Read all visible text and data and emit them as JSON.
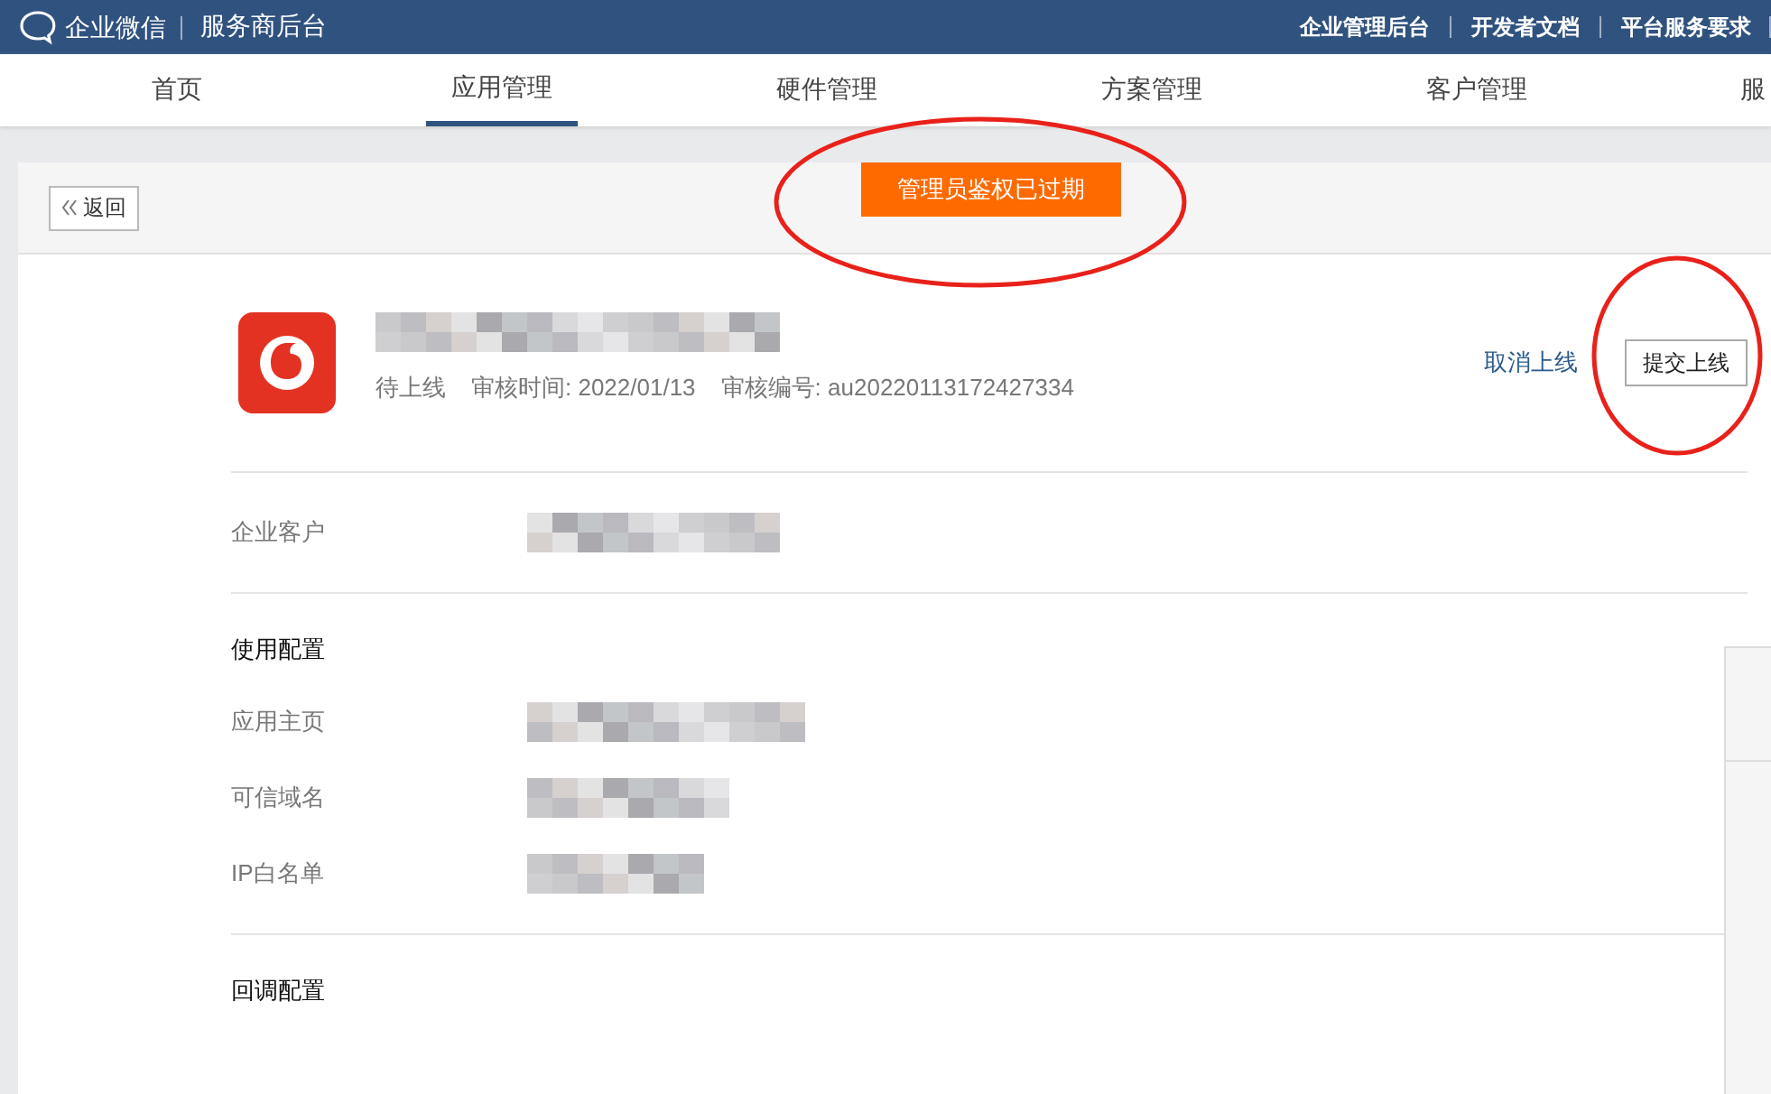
{
  "top_bar": {
    "brand": "企业微信",
    "subtitle": "服务商后台",
    "links": [
      "企业管理后台",
      "开发者文档",
      "平台服务要求"
    ]
  },
  "tabs": [
    {
      "label": "首页",
      "selected": false
    },
    {
      "label": "应用管理",
      "selected": true
    },
    {
      "label": "硬件管理",
      "selected": false
    },
    {
      "label": "方案管理",
      "selected": false
    },
    {
      "label": "客户管理",
      "selected": false
    },
    {
      "label": "服",
      "selected": false
    }
  ],
  "header": {
    "back": "返回",
    "toast": "管理员鉴权已过期"
  },
  "app": {
    "status": "待上线",
    "review_time": "审核时间: 2022/01/13",
    "review_id": "审核编号: au20220113172427334",
    "cancel": "取消上线",
    "submit": "提交上线"
  },
  "sections": [
    {
      "fields": [
        {
          "label": "企业客户"
        }
      ]
    },
    {
      "title": "使用配置",
      "fields": [
        {
          "label": "应用主页"
        },
        {
          "label": "可信域名"
        },
        {
          "label": "IP白名单"
        }
      ]
    },
    {
      "title": "回调配置"
    }
  ]
}
